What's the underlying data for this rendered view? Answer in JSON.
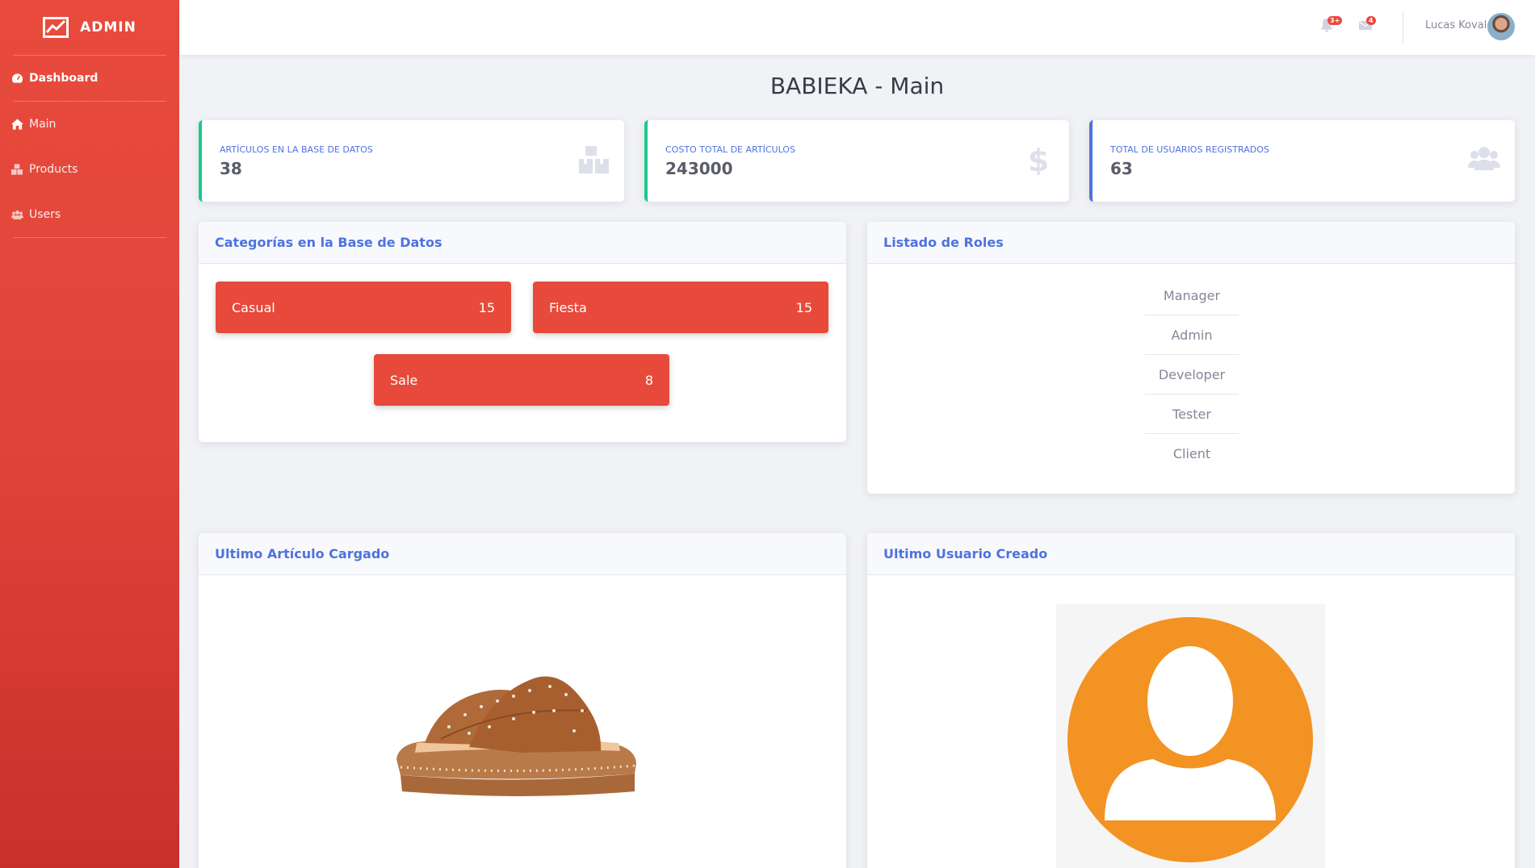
{
  "sidebar": {
    "brand": "ADMIN",
    "items": [
      {
        "label": "Dashboard",
        "icon": "tachometer-icon"
      },
      {
        "label": "Main",
        "icon": "home-icon"
      },
      {
        "label": "Products",
        "icon": "boxes-icon"
      },
      {
        "label": "Users",
        "icon": "users-icon"
      }
    ]
  },
  "topbar": {
    "alerts_badge": "3+",
    "messages_badge": "4",
    "user_name": "Lucas Koval"
  },
  "page": {
    "title": "BABIEKA - Main"
  },
  "stats": [
    {
      "label": "Artículos en la Base de Datos",
      "value": "38",
      "icon": "boxes-icon"
    },
    {
      "label": "Costo total de artículos",
      "value": "243000",
      "icon": "dollar-icon"
    },
    {
      "label": "Total de usuarios registrados",
      "value": "63",
      "icon": "users-icon"
    }
  ],
  "categories_card": {
    "title": "Categorías en la Base de Datos",
    "items": [
      {
        "name": "Casual",
        "count": "15"
      },
      {
        "name": "Fiesta",
        "count": "15"
      },
      {
        "name": "Sale",
        "count": "8"
      }
    ]
  },
  "roles_card": {
    "title": "Listado de Roles",
    "roles": [
      "Manager",
      "Admin",
      "Developer",
      "Tester",
      "Client"
    ]
  },
  "last_product_card": {
    "title": "Ultimo Artículo Cargado"
  },
  "last_user_card": {
    "title": "Ultimo Usuario Creado"
  },
  "colors": {
    "brand_red": "#e74a3b",
    "primary_blue": "#4e73df",
    "success_green": "#1cc88a",
    "avatar_orange": "#f39323"
  }
}
